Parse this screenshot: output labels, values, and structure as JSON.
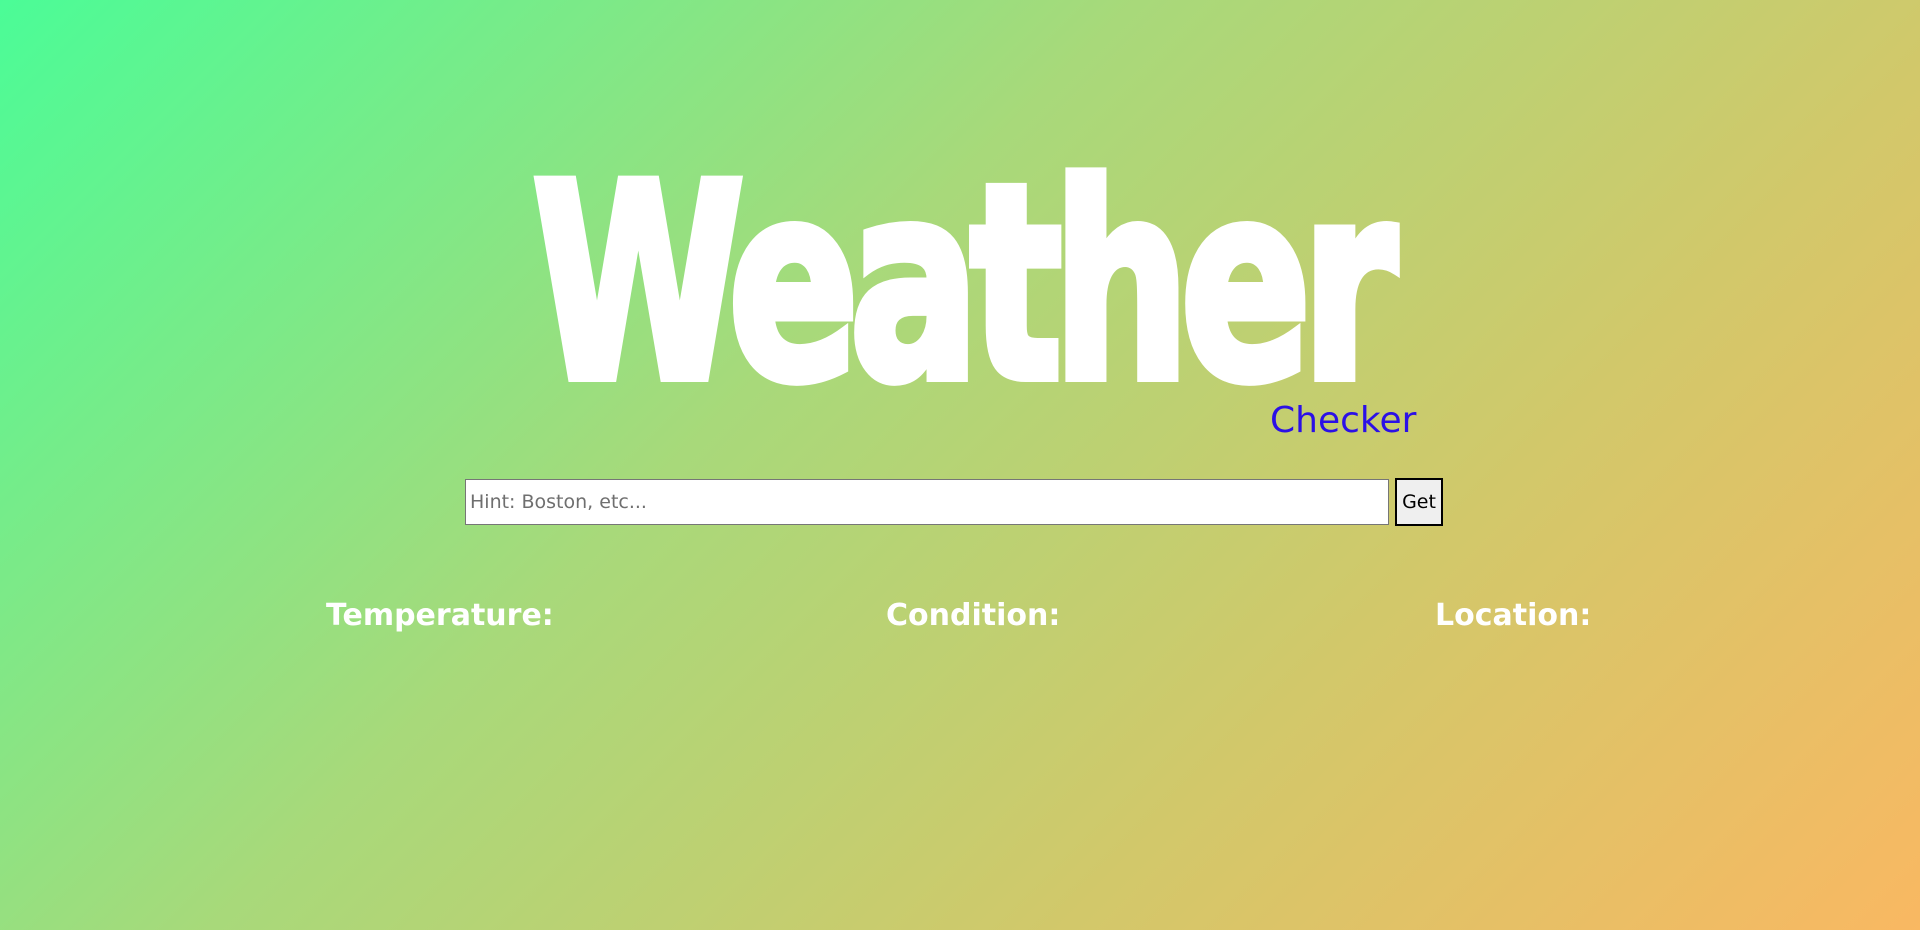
{
  "header": {
    "title": "Weather",
    "subtitle": "Checker"
  },
  "search": {
    "placeholder": "Hint: Boston, etc...",
    "value": "",
    "button_label": "Get"
  },
  "results": {
    "temperature_label": "Temperature:",
    "condition_label": "Condition:",
    "location_label": "Location:"
  },
  "colors": {
    "gradient_start": "#4bfc97",
    "gradient_end": "#f9b862",
    "subtitle": "#2b10e6",
    "title": "#ffffff"
  }
}
